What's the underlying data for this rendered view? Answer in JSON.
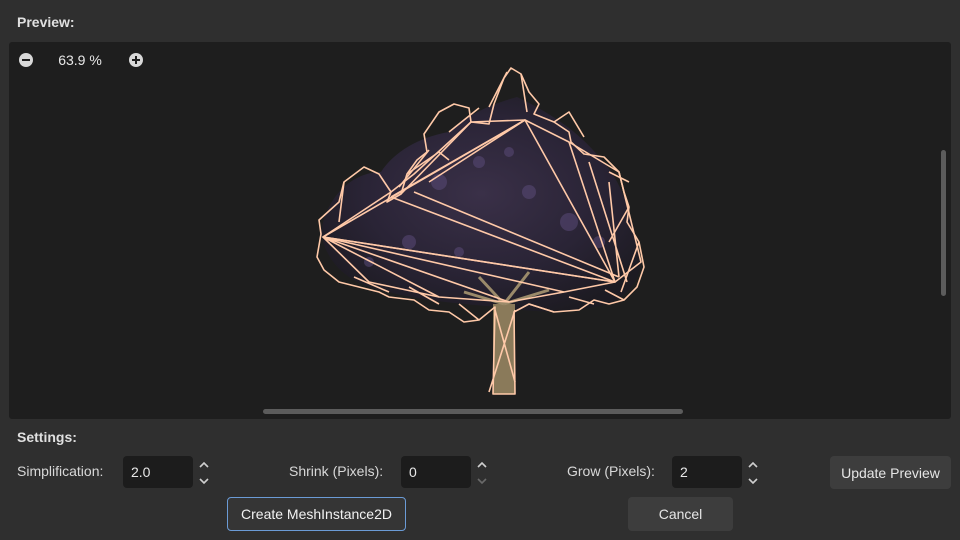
{
  "preview": {
    "title": "Preview:",
    "zoom_level": "63.9 %"
  },
  "settings": {
    "title": "Settings:",
    "simplification": {
      "label": "Simplification:",
      "value": "2.0"
    },
    "shrink": {
      "label": "Shrink (Pixels):",
      "value": "0"
    },
    "grow": {
      "label": "Grow (Pixels):",
      "value": "2"
    },
    "update_preview_label": "Update Preview"
  },
  "footer": {
    "create_label": "Create MeshInstance2D",
    "cancel_label": "Cancel"
  },
  "colors": {
    "outline": "#ffc9a8",
    "accent": "#6b9bd6",
    "background": "#2f2f2f",
    "panel": "#1e1e1e"
  },
  "icons": [
    "zoom-out-icon",
    "zoom-in-icon",
    "spin-arrows-icon"
  ]
}
